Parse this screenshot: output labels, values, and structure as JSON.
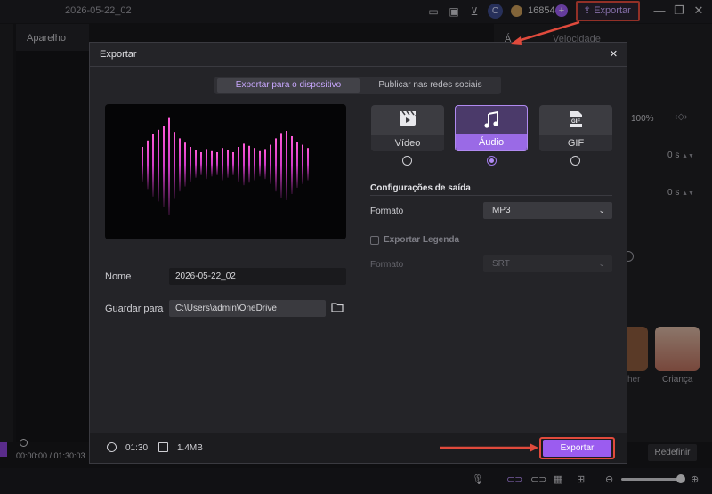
{
  "topbar": {
    "project_date": "2026-05-22_02",
    "avatar_letter": "C",
    "coins": "16854",
    "plus": "+",
    "export_label": "Exportar",
    "icons": [
      "layout-icon",
      "feedback-icon",
      "download-icon",
      "avatar",
      "coin-icon",
      "minimize-icon",
      "restore-icon",
      "close-icon"
    ]
  },
  "editor": {
    "left_tab": "Aparelho",
    "right_tab_a": "Á",
    "right_tab_speed": "Velocidade",
    "scale_value": "100%",
    "value_1": "0",
    "value_1_unit": "s",
    "value_2": "0",
    "value_2_unit": "s",
    "thumb_label_1": "her",
    "thumb_label_2": "Criança",
    "time_readout": "00:00:00 / 01:30:03",
    "reset_label": "Redefinir"
  },
  "dialog": {
    "title": "Exportar",
    "close_icon": "×",
    "tabs": [
      {
        "label": "Exportar para o dispositivo",
        "active": true
      },
      {
        "label": "Publicar nas redes sociais",
        "active": false
      }
    ],
    "name_label": "Nome",
    "name_value": "2026-05-22_02",
    "save_label": "Guardar para",
    "save_path": "C:\\Users\\admin\\OneDrive",
    "formats": [
      {
        "label": "Vídeo",
        "icon": "clapper-icon",
        "selected": false
      },
      {
        "label": "Áudio",
        "icon": "music-note-icon",
        "selected": true
      },
      {
        "label": "GIF",
        "icon": "gif-icon",
        "selected": false
      }
    ],
    "gif_badge": "GIF",
    "output_title": "Configurações de saída",
    "format_label": "Formato",
    "format_value": "MP3",
    "subtitle_label": "Exportar Legenda",
    "subtitle_format_label": "Formato",
    "subtitle_format_value": "SRT",
    "duration": "01:30",
    "file_size": "1.4MB",
    "export_button": "Exportar"
  },
  "colors": {
    "accent": "#9b5cf0",
    "highlight_border": "#e04a3c",
    "waveform": "#d23cc7"
  }
}
